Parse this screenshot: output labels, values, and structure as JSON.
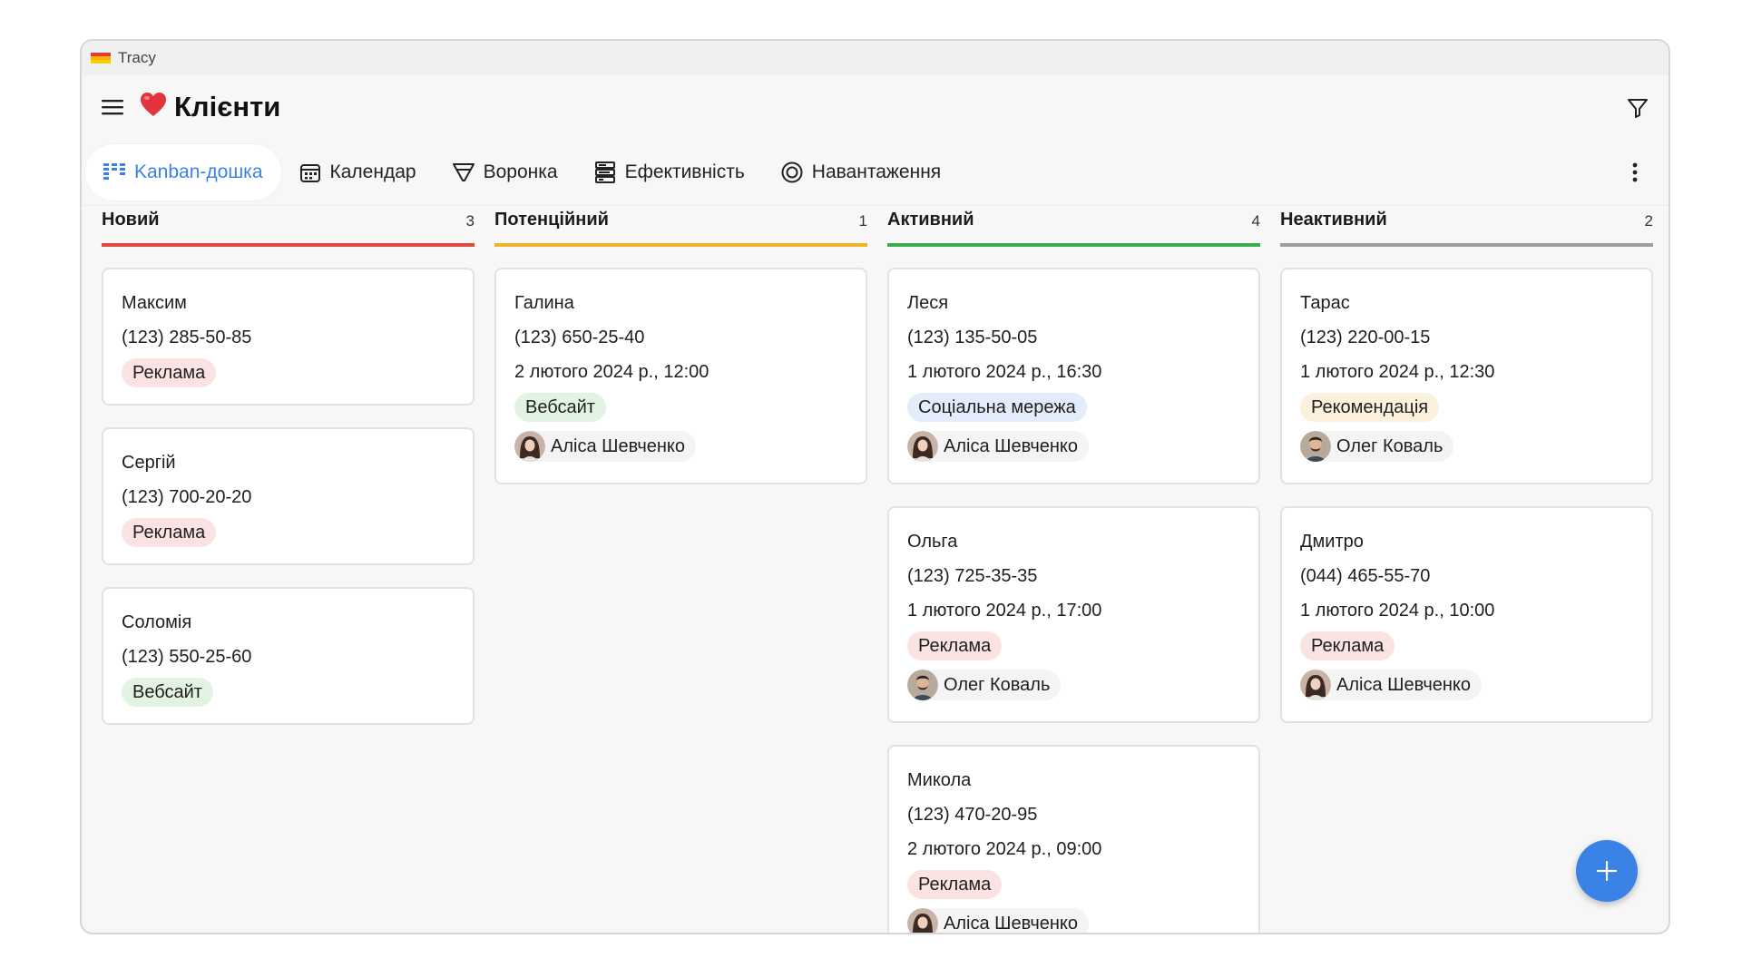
{
  "window": {
    "title": "Tracy",
    "logo_colors": [
      "#e33b3b",
      "#f5b400",
      "#f5d000"
    ]
  },
  "header": {
    "title": "Клієнти",
    "title_emoji": "❤️"
  },
  "tabs": [
    {
      "label": "Kanban-дошка",
      "icon": "kanban-icon",
      "active": true
    },
    {
      "label": "Календар",
      "icon": "calendar-icon",
      "active": false
    },
    {
      "label": "Воронка",
      "icon": "funnel-icon",
      "active": false
    },
    {
      "label": "Ефективність",
      "icon": "efficiency-icon",
      "active": false
    },
    {
      "label": "Навантаження",
      "icon": "workload-icon",
      "active": false
    }
  ],
  "tag_colors": {
    "Реклама": "#fbe3e3",
    "Вебсайт": "#e3f3e3",
    "Соціальна мережа": "#e3ecfb",
    "Рекомендація": "#fbf1dc"
  },
  "columns": [
    {
      "title": "Новий",
      "count": "3",
      "color": "#e04a3f",
      "cards": [
        {
          "name": "Максим",
          "phone": "(123) 285-50-85",
          "tag": "Реклама"
        },
        {
          "name": "Сергій",
          "phone": "(123) 700-20-20",
          "tag": "Реклама"
        },
        {
          "name": "Соломія",
          "phone": "(123) 550-25-60",
          "tag": "Вебсайт"
        }
      ]
    },
    {
      "title": "Потенційний",
      "count": "1",
      "color": "#f0b429",
      "cards": [
        {
          "name": "Галина",
          "phone": "(123) 650-25-40",
          "date": "2 лютого 2024 р., 12:00",
          "tag": "Вебсайт",
          "person": "Аліса Шевченко",
          "avatar": "female"
        }
      ]
    },
    {
      "title": "Активний",
      "count": "4",
      "color": "#3cad4c",
      "cards": [
        {
          "name": "Леся",
          "phone": "(123) 135-50-05",
          "date": "1 лютого 2024 р., 16:30",
          "tag": "Соціальна мережа",
          "person": "Аліса Шевченко",
          "avatar": "female"
        },
        {
          "name": "Ольга",
          "phone": "(123) 725-35-35",
          "date": "1 лютого 2024 р., 17:00",
          "tag": "Реклама",
          "person": "Олег Коваль",
          "avatar": "male"
        },
        {
          "name": "Микола",
          "phone": "(123) 470-20-95",
          "date": "2 лютого 2024 р., 09:00",
          "tag": "Реклама",
          "person": "Аліса Шевченко",
          "avatar": "female"
        }
      ]
    },
    {
      "title": "Неактивний",
      "count": "2",
      "color": "#9e9e9e",
      "cards": [
        {
          "name": "Тарас",
          "phone": "(123) 220-00-15",
          "date": "1 лютого 2024 р., 12:30",
          "tag": "Рекомендація",
          "person": "Олег Коваль",
          "avatar": "male"
        },
        {
          "name": "Дмитро",
          "phone": "(044) 465-55-70",
          "date": "1 лютого 2024 р., 10:00",
          "tag": "Реклама",
          "person": "Аліса Шевченко",
          "avatar": "female"
        }
      ]
    }
  ],
  "accent_color": "#3b82e6"
}
